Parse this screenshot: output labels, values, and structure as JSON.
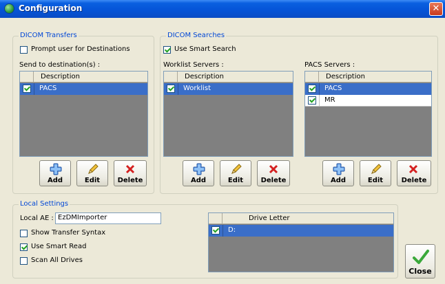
{
  "window": {
    "title": "Configuration"
  },
  "transfers": {
    "group_label": "DICOM Transfers",
    "prompt_label": "Prompt user for Destinations",
    "prompt_checked": false,
    "send_label": "Send to destination(s) :",
    "column": "Description",
    "rows": [
      {
        "text": "PACS",
        "checked": true,
        "selected": true
      }
    ]
  },
  "searches": {
    "group_label": "DICOM Searches",
    "smart_label": "Use Smart Search",
    "smart_checked": true,
    "worklist_label": "Worklist Servers :",
    "worklist_column": "Description",
    "worklist_rows": [
      {
        "text": "Worklist",
        "checked": true,
        "selected": true
      }
    ],
    "pacs_label": "PACS Servers :",
    "pacs_column": "Description",
    "pacs_rows": [
      {
        "text": "PACS",
        "checked": true,
        "selected": true
      },
      {
        "text": "MR",
        "checked": true,
        "selected": false
      }
    ]
  },
  "buttons": {
    "add": "Add",
    "edit": "Edit",
    "delete": "Delete"
  },
  "local": {
    "group_label": "Local Settings",
    "ae_label": "Local AE :",
    "ae_value": "EzDMImporter",
    "show_syntax_label": "Show Transfer Syntax",
    "show_syntax_checked": false,
    "smart_read_label": "Use Smart Read",
    "smart_read_checked": true,
    "scan_drives_label": "Scan All Drives",
    "scan_drives_checked": false,
    "drive_column": "Drive Letter",
    "drive_rows": [
      {
        "text": "D:",
        "checked": true,
        "selected": true
      }
    ]
  },
  "close_label": "Close",
  "colors": {
    "accent": "#0046d5",
    "selection": "#3a6ec8",
    "check": "#21a121"
  }
}
